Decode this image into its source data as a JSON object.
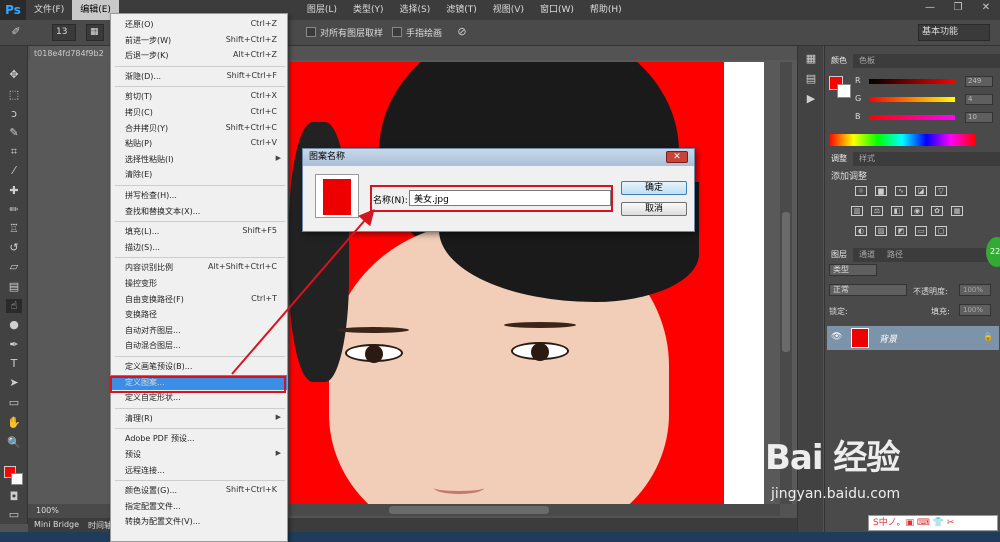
{
  "app": {
    "logo": "Ps",
    "workspace": "基本功能"
  },
  "menubar": {
    "items": [
      "文件(F)",
      "编辑(E)",
      "图层(L)",
      "类型(Y)",
      "选择(S)",
      "滤镜(T)",
      "视图(V)",
      "窗口(W)",
      "帮助(H)"
    ],
    "active_index": 1
  },
  "options": {
    "brush_size": "13",
    "sample_all_layers": "对所有图层取样",
    "finger_painting": "手指绘画"
  },
  "document": {
    "tab": "t018e4fd784f9b2",
    "zoom": "100%",
    "bottom_tabs": [
      "Mini Bridge",
      "时间轴"
    ]
  },
  "edit_menu": {
    "items": [
      {
        "label": "还原(O)",
        "shortcut": "Ctrl+Z",
        "disabled": false
      },
      {
        "label": "前进一步(W)",
        "shortcut": "Shift+Ctrl+Z",
        "disabled": false
      },
      {
        "label": "后退一步(K)",
        "shortcut": "Alt+Ctrl+Z",
        "disabled": false
      },
      {
        "sep": true
      },
      {
        "label": "渐隐(D)...",
        "shortcut": "Shift+Ctrl+F",
        "disabled": false
      },
      {
        "sep": true
      },
      {
        "label": "剪切(T)",
        "shortcut": "Ctrl+X",
        "disabled": false
      },
      {
        "label": "拷贝(C)",
        "shortcut": "Ctrl+C",
        "disabled": false
      },
      {
        "label": "合并拷贝(Y)",
        "shortcut": "Shift+Ctrl+C",
        "disabled": false
      },
      {
        "label": "粘贴(P)",
        "shortcut": "Ctrl+V",
        "disabled": false
      },
      {
        "label": "选择性粘贴(I)",
        "shortcut": "",
        "arrow": true,
        "disabled": false
      },
      {
        "label": "清除(E)",
        "shortcut": "",
        "disabled": false
      },
      {
        "sep": true
      },
      {
        "label": "拼写检查(H)...",
        "shortcut": "",
        "disabled": false
      },
      {
        "label": "查找和替换文本(X)...",
        "shortcut": "",
        "disabled": false
      },
      {
        "sep": true
      },
      {
        "label": "填充(L)...",
        "shortcut": "Shift+F5",
        "disabled": false
      },
      {
        "label": "描边(S)...",
        "shortcut": "",
        "disabled": false
      },
      {
        "sep": true
      },
      {
        "label": "内容识别比例",
        "shortcut": "Alt+Shift+Ctrl+C",
        "disabled": false
      },
      {
        "label": "操控变形",
        "shortcut": "",
        "disabled": false
      },
      {
        "label": "自由变换路径(F)",
        "shortcut": "Ctrl+T",
        "disabled": false
      },
      {
        "label": "变换路径",
        "shortcut": "",
        "disabled": false
      },
      {
        "label": "自动对齐图层...",
        "shortcut": "",
        "disabled": false
      },
      {
        "label": "自动混合图层...",
        "shortcut": "",
        "disabled": false
      },
      {
        "sep": true
      },
      {
        "label": "定义画笔预设(B)...",
        "shortcut": "",
        "disabled": false
      },
      {
        "label": "定义图案...",
        "shortcut": "",
        "disabled": false,
        "highlight": true
      },
      {
        "label": "定义自定形状...",
        "shortcut": "",
        "disabled": false
      },
      {
        "sep": true
      },
      {
        "label": "清理(R)",
        "shortcut": "",
        "arrow": true,
        "disabled": false
      },
      {
        "sep": true
      },
      {
        "label": "Adobe PDF 预设...",
        "shortcut": "",
        "disabled": false
      },
      {
        "label": "预设",
        "shortcut": "",
        "arrow": true,
        "disabled": false
      },
      {
        "label": "远程连接...",
        "shortcut": "",
        "disabled": false
      },
      {
        "sep": true
      },
      {
        "label": "颜色设置(G)...",
        "shortcut": "Shift+Ctrl+K",
        "disabled": false
      },
      {
        "label": "指定配置文件...",
        "shortcut": "",
        "disabled": false
      },
      {
        "label": "转换为配置文件(V)...",
        "shortcut": "",
        "disabled": false
      }
    ]
  },
  "dialog": {
    "title": "图案名称",
    "name_label": "名称(N):",
    "name_value": "美女.jpg",
    "ok": "确定",
    "cancel": "取消"
  },
  "color_panel": {
    "tabs": [
      "颜色",
      "色板"
    ],
    "r_label": "R",
    "g_label": "G",
    "b_label": "B",
    "r": "249",
    "g": "4",
    "b": "10"
  },
  "adjust_panel": {
    "tabs": [
      "调整",
      "样式"
    ],
    "title": "添加调整"
  },
  "layers_panel": {
    "tabs": [
      "图层",
      "通道",
      "路径"
    ],
    "kind": "类型",
    "blend": "正常",
    "opacity_label": "不透明度:",
    "opacity": "100%",
    "lock_label": "锁定:",
    "fill_label": "填充:",
    "fill": "100%",
    "layer_name": "背景"
  },
  "watermark": {
    "logo": "Bai 经验",
    "url": "jingyan.baidu.com"
  },
  "ime": {
    "text": "S中ノ。▣ ⌨ 👕 ✂"
  },
  "colors": {
    "accent": "#3a8ee6",
    "red_box": "#d7131f",
    "photo_bg": "#ff0000"
  }
}
